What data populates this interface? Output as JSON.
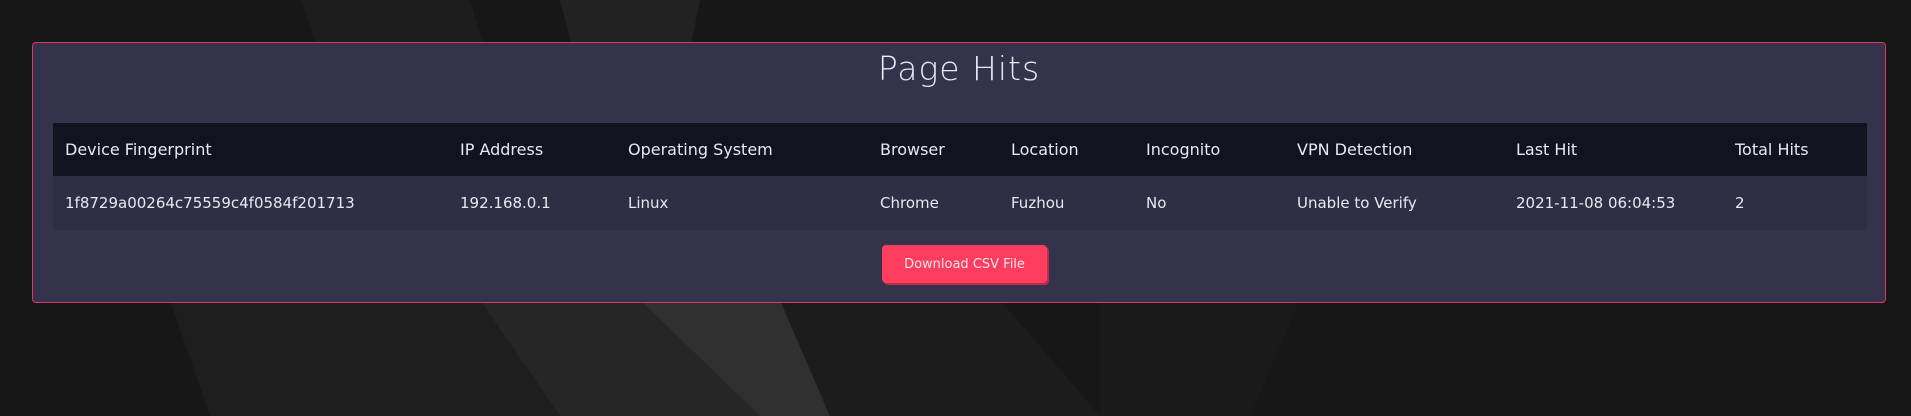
{
  "page": {
    "title": "Page Hits"
  },
  "table": {
    "columns": [
      "Device Fingerprint",
      "IP Address",
      "Operating System",
      "Browser",
      "Location",
      "Incognito",
      "VPN Detection",
      "Last Hit",
      "Total Hits"
    ],
    "rows": [
      {
        "fingerprint": "1f8729a00264c75559c4f0584f201713",
        "ip": "192.168.0.1",
        "os": "Linux",
        "browser": "Chrome",
        "location": "Fuzhou",
        "incognito": "No",
        "vpn": "Unable to Verify",
        "last_hit": "2021-11-08 06:04:53",
        "total_hits": "2"
      }
    ]
  },
  "actions": {
    "download_label": "Download CSV File"
  },
  "colors": {
    "panel_bg": "#33334c",
    "panel_border": "#e0375a",
    "header_bg": "#131320",
    "accent_button": "#ff3d5f"
  }
}
